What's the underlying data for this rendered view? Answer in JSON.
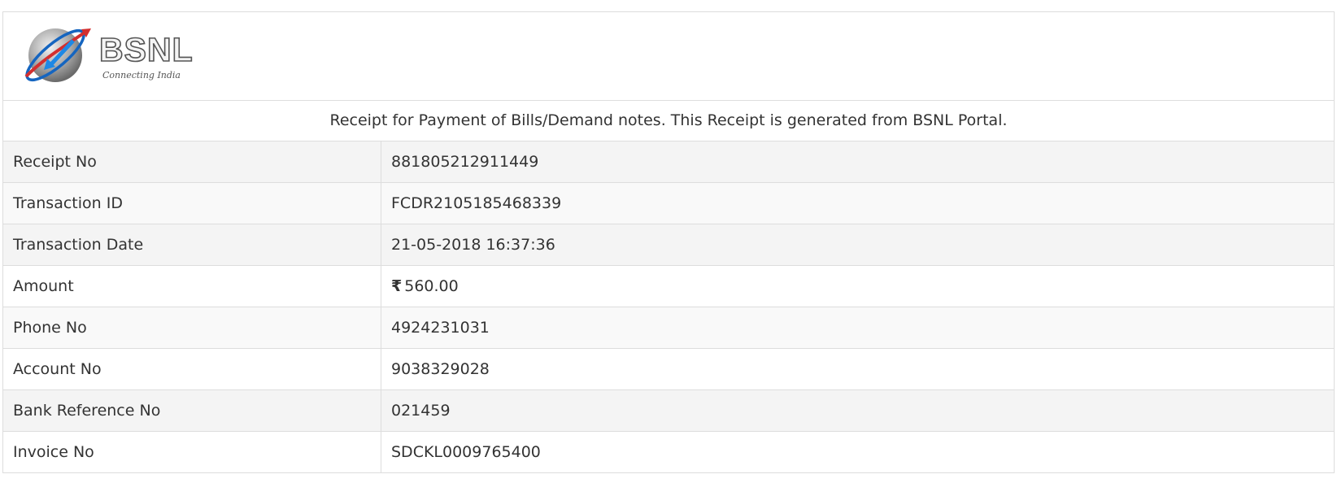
{
  "logo": {
    "name": "BSNL",
    "tagline": "Connecting India"
  },
  "caption": "Receipt for Payment of Bills/Demand notes. This Receipt is generated from BSNL Portal.",
  "fields": {
    "receipt_no": {
      "label": "Receipt No",
      "value": "881805212911449"
    },
    "transaction_id": {
      "label": "Transaction ID",
      "value": "FCDR2105185468339"
    },
    "transaction_date": {
      "label": "Transaction Date",
      "value": "21-05-2018 16:37:36"
    },
    "amount": {
      "label": "Amount",
      "currency_symbol": "₹",
      "value": "560.00"
    },
    "phone_no": {
      "label": "Phone No",
      "value": "4924231031"
    },
    "account_no": {
      "label": "Account No",
      "value": "9038329028"
    },
    "bank_reference_no": {
      "label": "Bank Reference No",
      "value": "021459"
    },
    "invoice_no": {
      "label": "Invoice No",
      "value": "SDCKL0009765400"
    }
  },
  "colors": {
    "border": "#dddddd",
    "row_shade_dark": "#f4f4f4",
    "row_shade_light": "#f9f9f9",
    "text": "#333333",
    "logo_red": "#d32f2f",
    "logo_blue": "#1e88e5"
  }
}
